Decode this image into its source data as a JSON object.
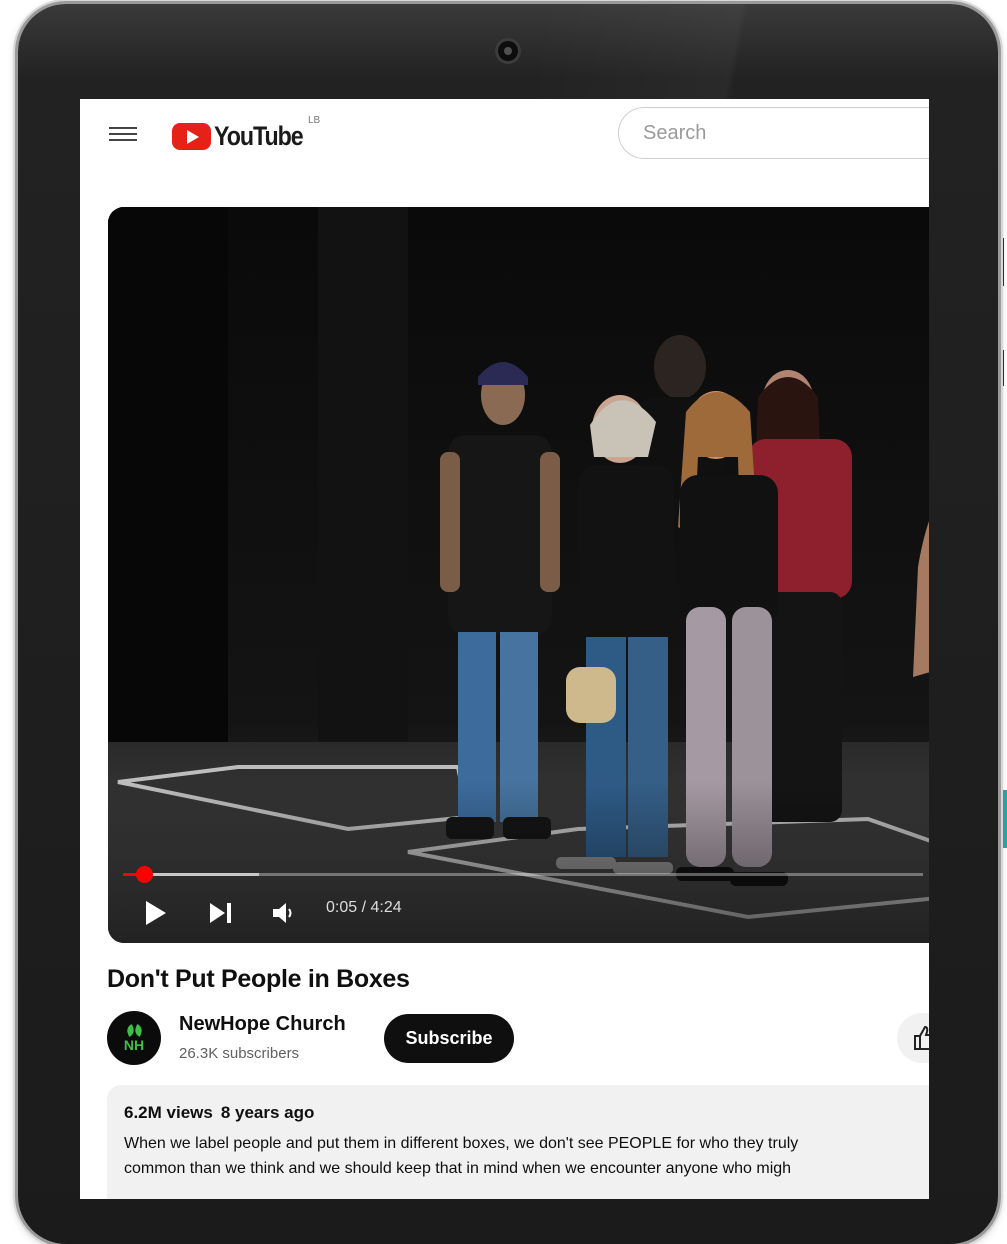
{
  "header": {
    "logo_text": "YouTube",
    "logo_superscript": "LB",
    "search_placeholder": "Search"
  },
  "player": {
    "time_display": "0:05 / 4:24",
    "progress_fraction": 0.019,
    "buffered_fraction": 0.17
  },
  "video": {
    "title": "Don't Put People in Boxes"
  },
  "channel": {
    "avatar_text": "NH",
    "name": "NewHope Church",
    "subscribers": "26.3K subscribers",
    "subscribe_label": "Subscribe"
  },
  "description": {
    "views": "6.2M views",
    "age": "8 years ago",
    "line1": "When we label people and put them in different boxes, we don't see PEOPLE for who they truly",
    "line2": "common than we think and we should keep that in mind when we encounter anyone who migh"
  },
  "colors": {
    "brand_red": "#e62117",
    "progress_red": "#ff0000",
    "avatar_green": "#3fbf4a",
    "teal_accent": "#2aa7a9"
  }
}
